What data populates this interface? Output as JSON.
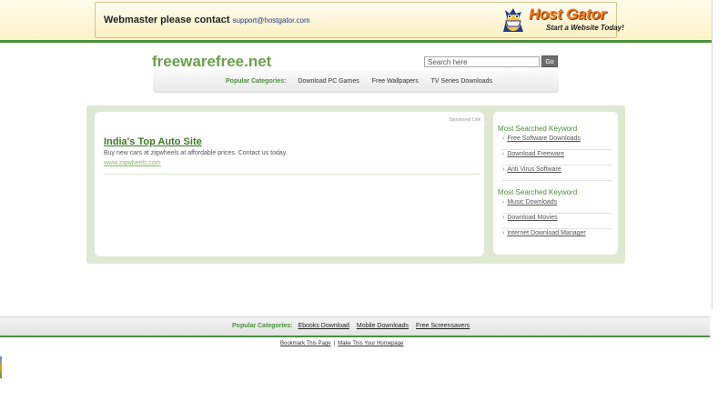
{
  "banner": {
    "text": "Webmaster please contact",
    "email": "support@hostgator.com",
    "logo_name": "Host Gator",
    "logo_tagline": "Start a Website Today!"
  },
  "header": {
    "site_title": "freewarefree.net",
    "search": {
      "placeholder": "Search here",
      "value": "Search here"
    },
    "go_label": "Go",
    "categories_label": "Popular Categories:",
    "categories": [
      "Download PC Games",
      "Free Wallpapers",
      "TV Series Downloads"
    ]
  },
  "ad": {
    "sponsored_label": "Sponsored Link",
    "title": "India's Top Auto Site",
    "description": "Buy new cars at zigwheels at affordable prices. Contact us today.",
    "url": "www.zigwheels.com"
  },
  "sidebar": {
    "sections": [
      {
        "heading": "Most Searched Keyword",
        "items": [
          "Free Software Downloads",
          "Download Freeware",
          "Anti Virus Software"
        ]
      },
      {
        "heading": "Most Searched Keyword",
        "items": [
          "Music Downloads",
          "Download Movies",
          "Internet Download Manager"
        ]
      }
    ]
  },
  "footer": {
    "categories_label": "Popular Categories:",
    "categories": [
      "Ebooks Download",
      "Mobile Downloads",
      "Free Screensavers"
    ],
    "links": [
      "Bookmark This Page",
      "Make This Your Homepage"
    ],
    "separator": "|"
  },
  "colors": {
    "accent_green": "#4a8f3c",
    "title_green": "#6aa04a",
    "content_bg": "#dfe9d2",
    "banner_bg": "#fdf3c9",
    "hostgator_orange": "#f0781e"
  },
  "icons": {
    "logo": "hostgator-gator-icon"
  }
}
